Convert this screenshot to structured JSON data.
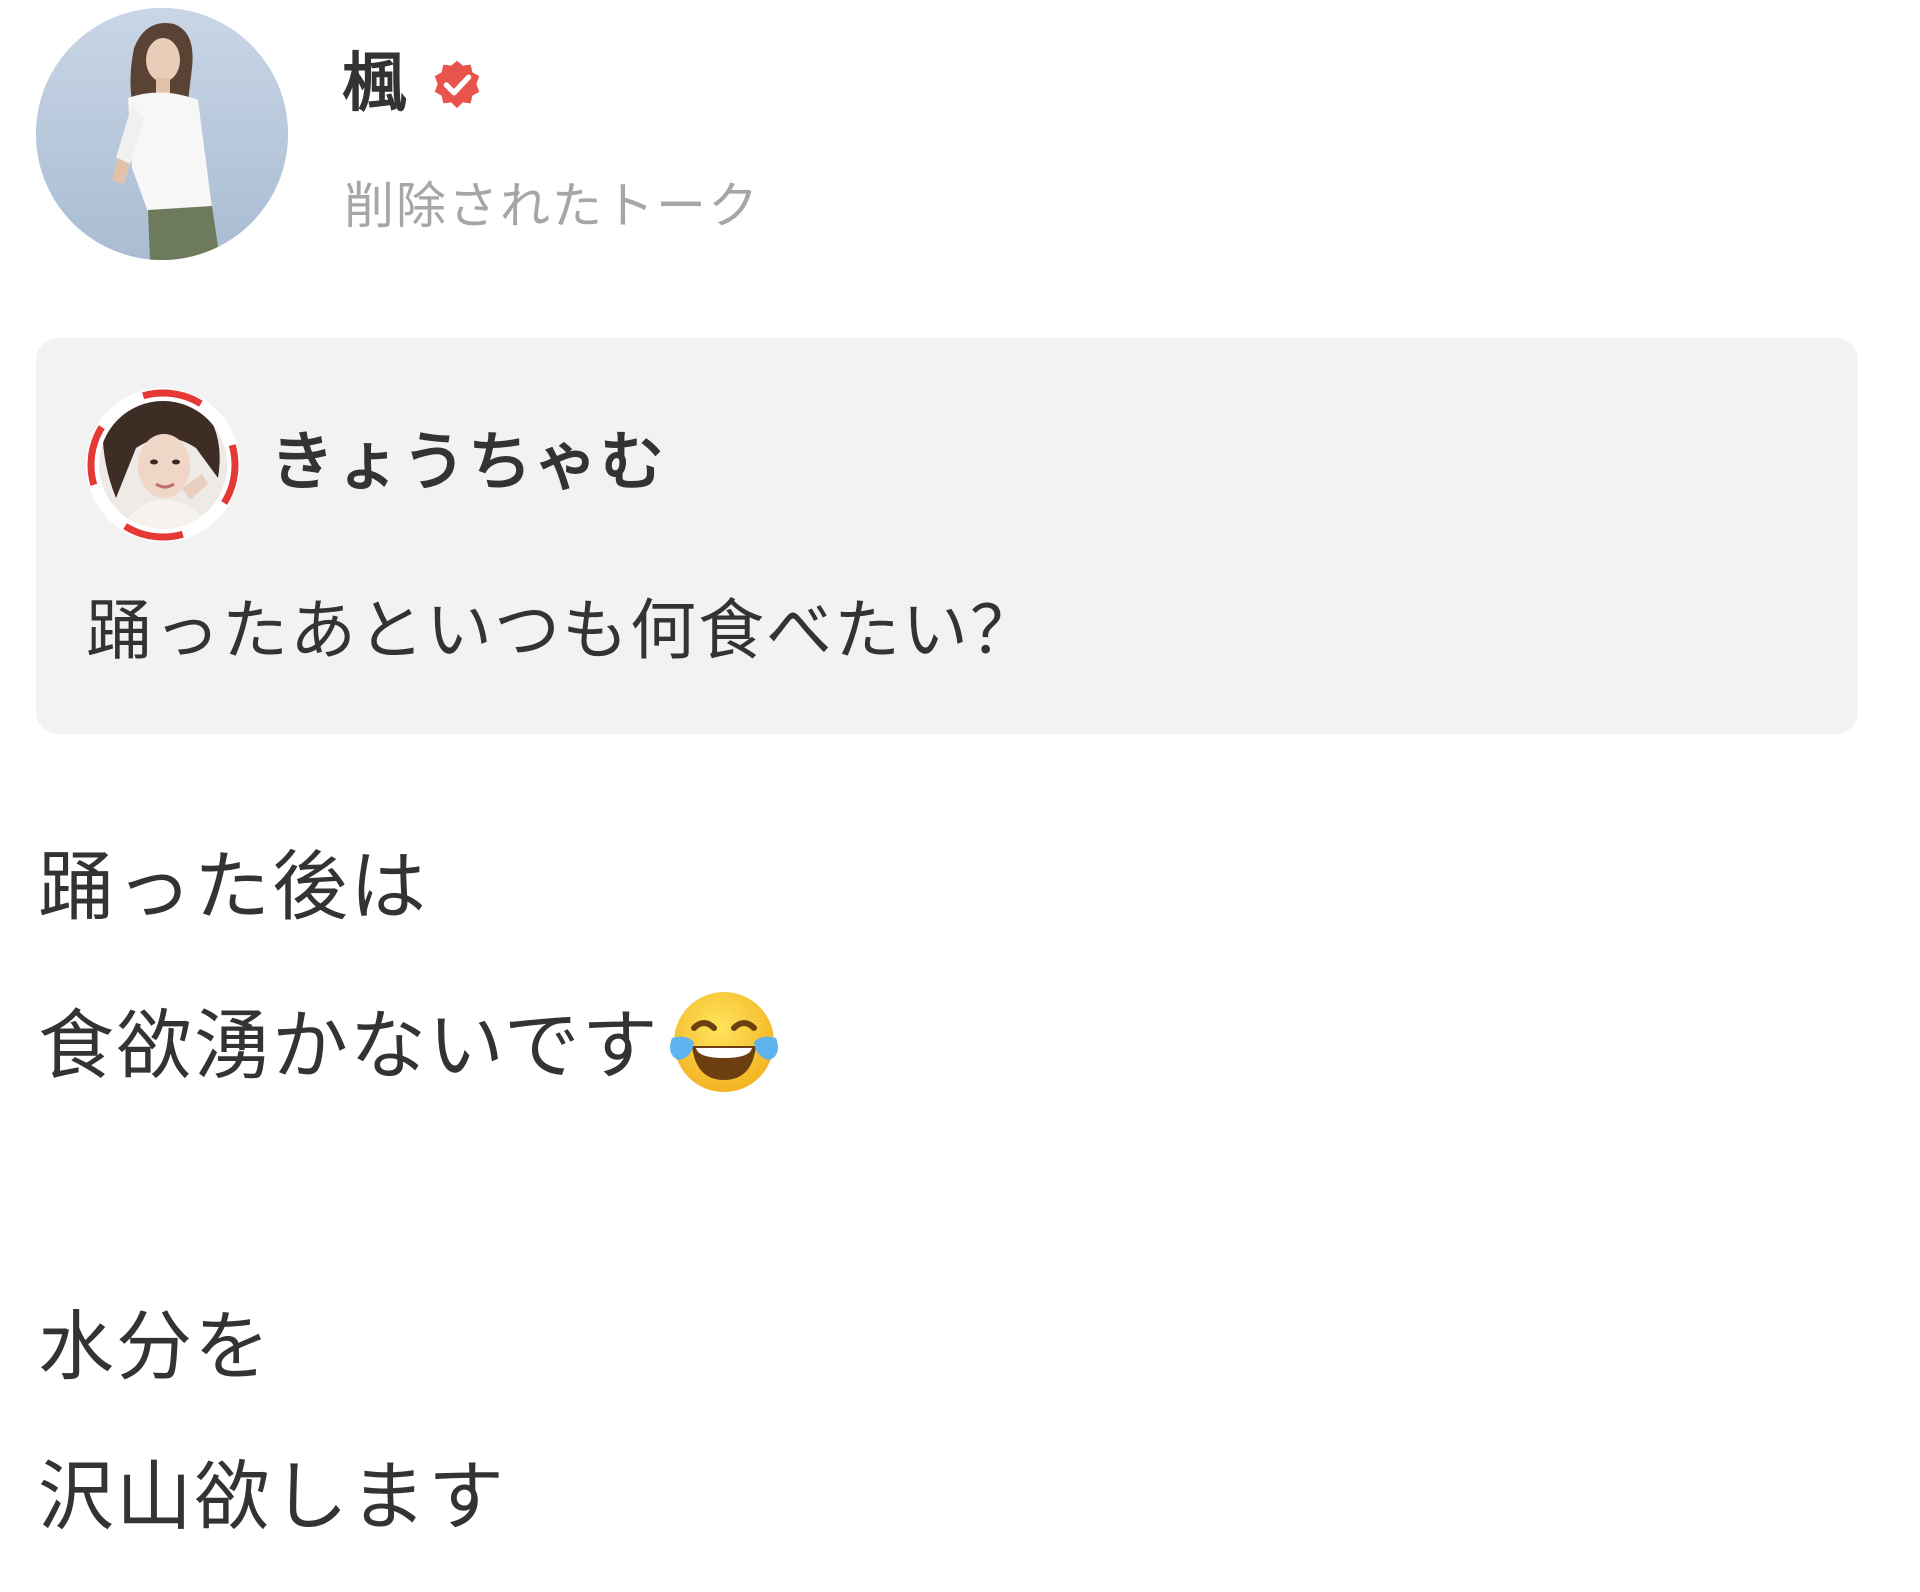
{
  "header": {
    "author_name": "楓",
    "subtitle": "削除されたトーク",
    "avatar_icon": "avatar-photo-icon",
    "verified_icon": "verified-check-icon",
    "verified_color": "#e8544c"
  },
  "quote": {
    "user_name": "きょうちゃむ",
    "text": "踊ったあといつも何食べたい？",
    "avatar_ring_color": "#e53935",
    "background_color": "#f2f2f2"
  },
  "answer": {
    "lines": [
      "踊った後は",
      "食欲湧かないです",
      "水分を",
      "沢山欲します"
    ],
    "emoji_icon": "face-with-tears-of-joy-icon"
  },
  "colors": {
    "text": "#333333",
    "subtext": "#a6a6a6"
  }
}
